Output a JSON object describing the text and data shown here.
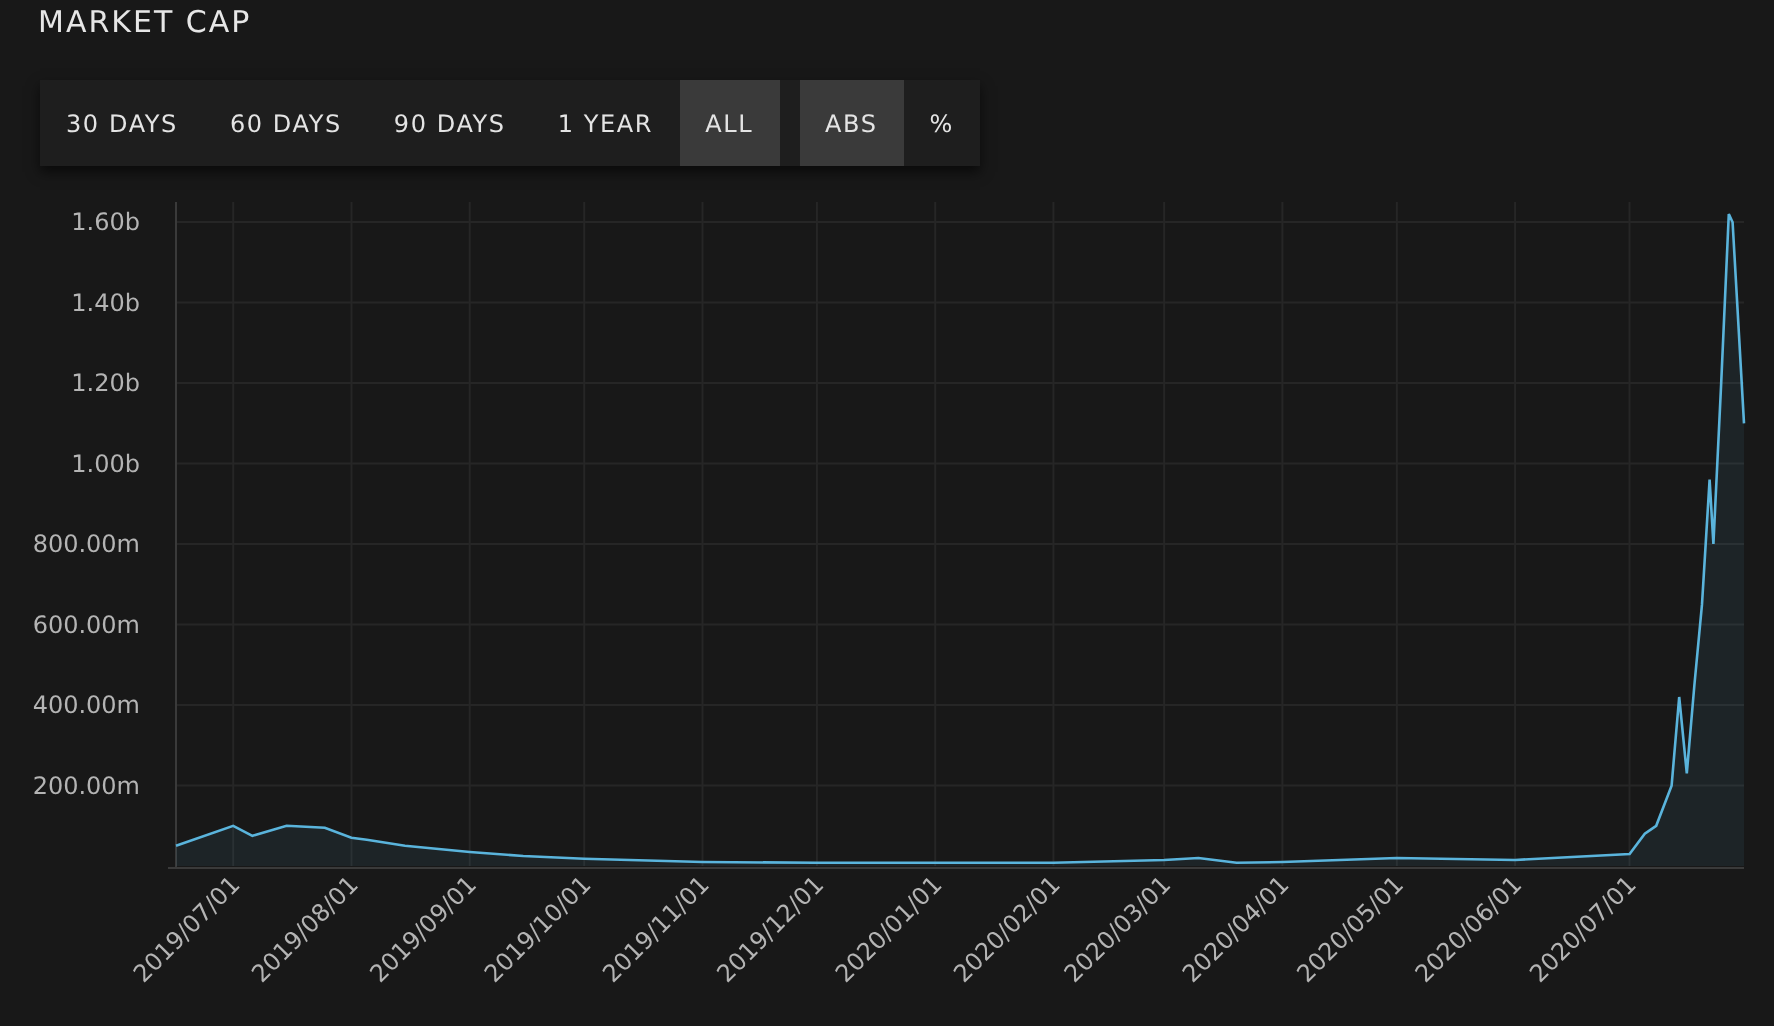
{
  "title": "MARKET CAP",
  "range_buttons": [
    {
      "label": "30 DAYS",
      "selected": false
    },
    {
      "label": "60 DAYS",
      "selected": false
    },
    {
      "label": "90 DAYS",
      "selected": false
    },
    {
      "label": "1 YEAR",
      "selected": false
    },
    {
      "label": "ALL",
      "selected": true
    }
  ],
  "mode_buttons": [
    {
      "label": "ABS",
      "selected": true
    },
    {
      "label": "%",
      "selected": false
    }
  ],
  "chart": {
    "chart_data": {
      "type": "area",
      "grid": true,
      "x": [
        "2019-06-16",
        "2019-07-01",
        "2019-07-06",
        "2019-07-15",
        "2019-07-25",
        "2019-08-01",
        "2019-08-05",
        "2019-08-15",
        "2019-09-01",
        "2019-09-15",
        "2019-10-01",
        "2019-11-01",
        "2019-12-01",
        "2020-01-01",
        "2020-02-01",
        "2020-03-01",
        "2020-03-10",
        "2020-03-20",
        "2020-04-01",
        "2020-05-01",
        "2020-06-01",
        "2020-07-01",
        "2020-07-05",
        "2020-07-08",
        "2020-07-12",
        "2020-07-14",
        "2020-07-16",
        "2020-07-18",
        "2020-07-20",
        "2020-07-22",
        "2020-07-23",
        "2020-07-25",
        "2020-07-27",
        "2020-07-28",
        "2020-07-31"
      ],
      "series": [
        {
          "color": "#5ab4dc",
          "values": [
            50000000,
            100000000,
            75000000,
            100000000,
            95000000,
            70000000,
            65000000,
            50000000,
            35000000,
            25000000,
            18000000,
            10000000,
            8000000,
            8000000,
            8000000,
            15000000,
            20000000,
            8000000,
            10000000,
            20000000,
            15000000,
            30000000,
            80000000,
            100000000,
            200000000,
            420000000,
            230000000,
            450000000,
            650000000,
            960000000,
            800000000,
            1200000000,
            1620000000,
            1600000000,
            1100000000
          ]
        }
      ],
      "xlim": [
        "2019-06-16",
        "2020-07-31"
      ],
      "ylim": [
        0,
        1650000000
      ],
      "yticks": [
        {
          "value": 200000000,
          "label": "200.00m"
        },
        {
          "value": 400000000,
          "label": "400.00m"
        },
        {
          "value": 600000000,
          "label": "600.00m"
        },
        {
          "value": 800000000,
          "label": "800.00m"
        },
        {
          "value": 1000000000,
          "label": "1.00b"
        },
        {
          "value": 1200000000,
          "label": "1.20b"
        },
        {
          "value": 1400000000,
          "label": "1.40b"
        },
        {
          "value": 1600000000,
          "label": "1.60b"
        }
      ],
      "xticks": [
        {
          "value": "2019-07-01",
          "label": "2019/07/01"
        },
        {
          "value": "2019-08-01",
          "label": "2019/08/01"
        },
        {
          "value": "2019-09-01",
          "label": "2019/09/01"
        },
        {
          "value": "2019-10-01",
          "label": "2019/10/01"
        },
        {
          "value": "2019-11-01",
          "label": "2019/11/01"
        },
        {
          "value": "2019-12-01",
          "label": "2019/12/01"
        },
        {
          "value": "2020-01-01",
          "label": "2020/01/01"
        },
        {
          "value": "2020-02-01",
          "label": "2020/02/01"
        },
        {
          "value": "2020-03-01",
          "label": "2020/03/01"
        },
        {
          "value": "2020-04-01",
          "label": "2020/04/01"
        },
        {
          "value": "2020-05-01",
          "label": "2020/05/01"
        },
        {
          "value": "2020-06-01",
          "label": "2020/06/01"
        },
        {
          "value": "2020-07-01",
          "label": "2020/07/01"
        }
      ]
    }
  }
}
